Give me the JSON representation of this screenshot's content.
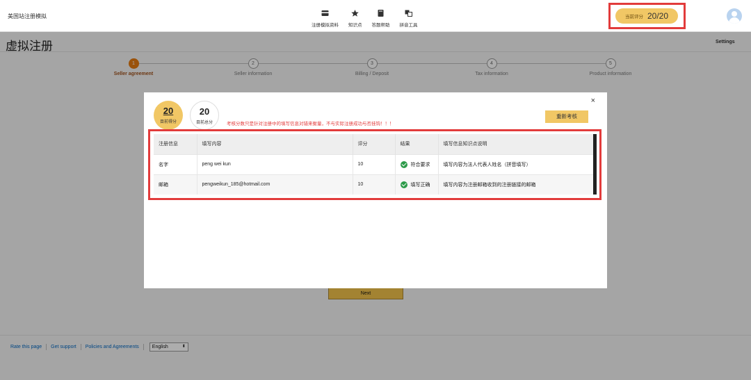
{
  "app": {
    "title": "美国站注册模拟"
  },
  "nav": {
    "items": [
      {
        "label": "注册模拟资料",
        "icon": "card-icon"
      },
      {
        "label": "知识点",
        "icon": "star-icon"
      },
      {
        "label": "答题帮助",
        "icon": "book-icon"
      },
      {
        "label": "拼音工具",
        "icon": "translate-icon"
      }
    ]
  },
  "score_badge": {
    "label": "当前评分",
    "value": "20/20"
  },
  "page": {
    "title": "虚拟注册",
    "settings": "Settings"
  },
  "steps": [
    {
      "num": "1",
      "label": "Seller agreement",
      "active": true
    },
    {
      "num": "2",
      "label": "Seller information",
      "active": false
    },
    {
      "num": "3",
      "label": "Billing / Deposit",
      "active": false
    },
    {
      "num": "4",
      "label": "Tax information",
      "active": false
    },
    {
      "num": "5",
      "label": "Product information",
      "active": false
    }
  ],
  "next_button": "Next",
  "footer": {
    "rate": "Rate this page",
    "support": "Get support",
    "policies": "Policies and Agreements",
    "language": "English"
  },
  "modal": {
    "close": "×",
    "current_score": {
      "value": "20",
      "label": "目前得分"
    },
    "total_score": {
      "value": "20",
      "label": "目前总分"
    },
    "notice": "考核分数只是针对注册中的填写信息对错来衡量，不与实际注册成功与否挂钩！！！",
    "retest_button": "重新考核",
    "table": {
      "headers": [
        "注册信息",
        "填写内容",
        "评分",
        "结果",
        "填写信息知识点说明"
      ],
      "rows": [
        {
          "field": "名字",
          "content": "peng wei kun",
          "score": "10",
          "result": "符合要求",
          "note": "填写内容为法人代表人姓名（拼音填写）"
        },
        {
          "field": "邮箱",
          "content": "pengweikun_185@hotmail.com",
          "score": "10",
          "result": "填写正确",
          "note": "填写内容为注册邮箱收到的注册链接的邮箱"
        }
      ]
    }
  },
  "colors": {
    "accent": "#f1c765",
    "highlight": "#e23b3b",
    "success": "#2e9b4a",
    "step_active": "#e47911"
  }
}
